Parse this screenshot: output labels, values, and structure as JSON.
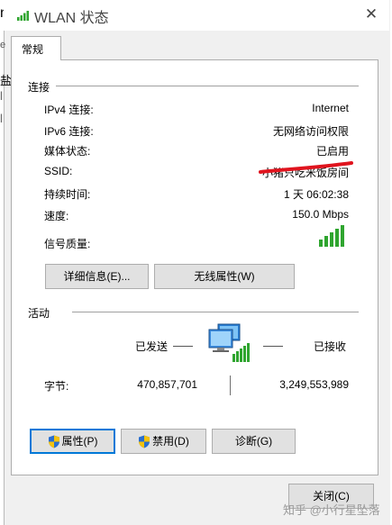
{
  "window": {
    "title": "WLAN 状态",
    "left_edge_fragments": [
      "n",
      "e",
      "盐",
      "l",
      "l"
    ]
  },
  "tabs": [
    {
      "label": "常规"
    }
  ],
  "connection": {
    "section_title": "连接",
    "rows": [
      {
        "label": "IPv4 连接:",
        "value": "Internet"
      },
      {
        "label": "IPv6 连接:",
        "value": "无网络访问权限"
      },
      {
        "label": "媒体状态:",
        "value": "已启用"
      },
      {
        "label": "SSID:",
        "value": "小猪只吃米饭房间"
      },
      {
        "label": "持续时间:",
        "value": "1 天 06:02:38"
      },
      {
        "label": "速度:",
        "value": "150.0 Mbps"
      }
    ],
    "signal_label": "信号质量:",
    "signal_bars_filled": 5,
    "signal_bars_total": 5,
    "details_button": "详细信息(E)...",
    "wireless_props_button": "无线属性(W)"
  },
  "activity": {
    "section_title": "活动",
    "sent_label": "已发送",
    "received_label": "已接收",
    "bytes_label": "字节:",
    "bytes_sent": "470,857,701",
    "bytes_received": "3,249,553,989"
  },
  "actions": {
    "properties_button": "属性(P)",
    "disable_button": "禁用(D)",
    "diagnose_button": "诊断(G)",
    "close_button": "关闭(C)"
  },
  "watermark": "知乎 @小行星坠落",
  "colors": {
    "accent": "#0078d7",
    "signal_green": "#2fa52f",
    "redaction": "#e0141e"
  }
}
